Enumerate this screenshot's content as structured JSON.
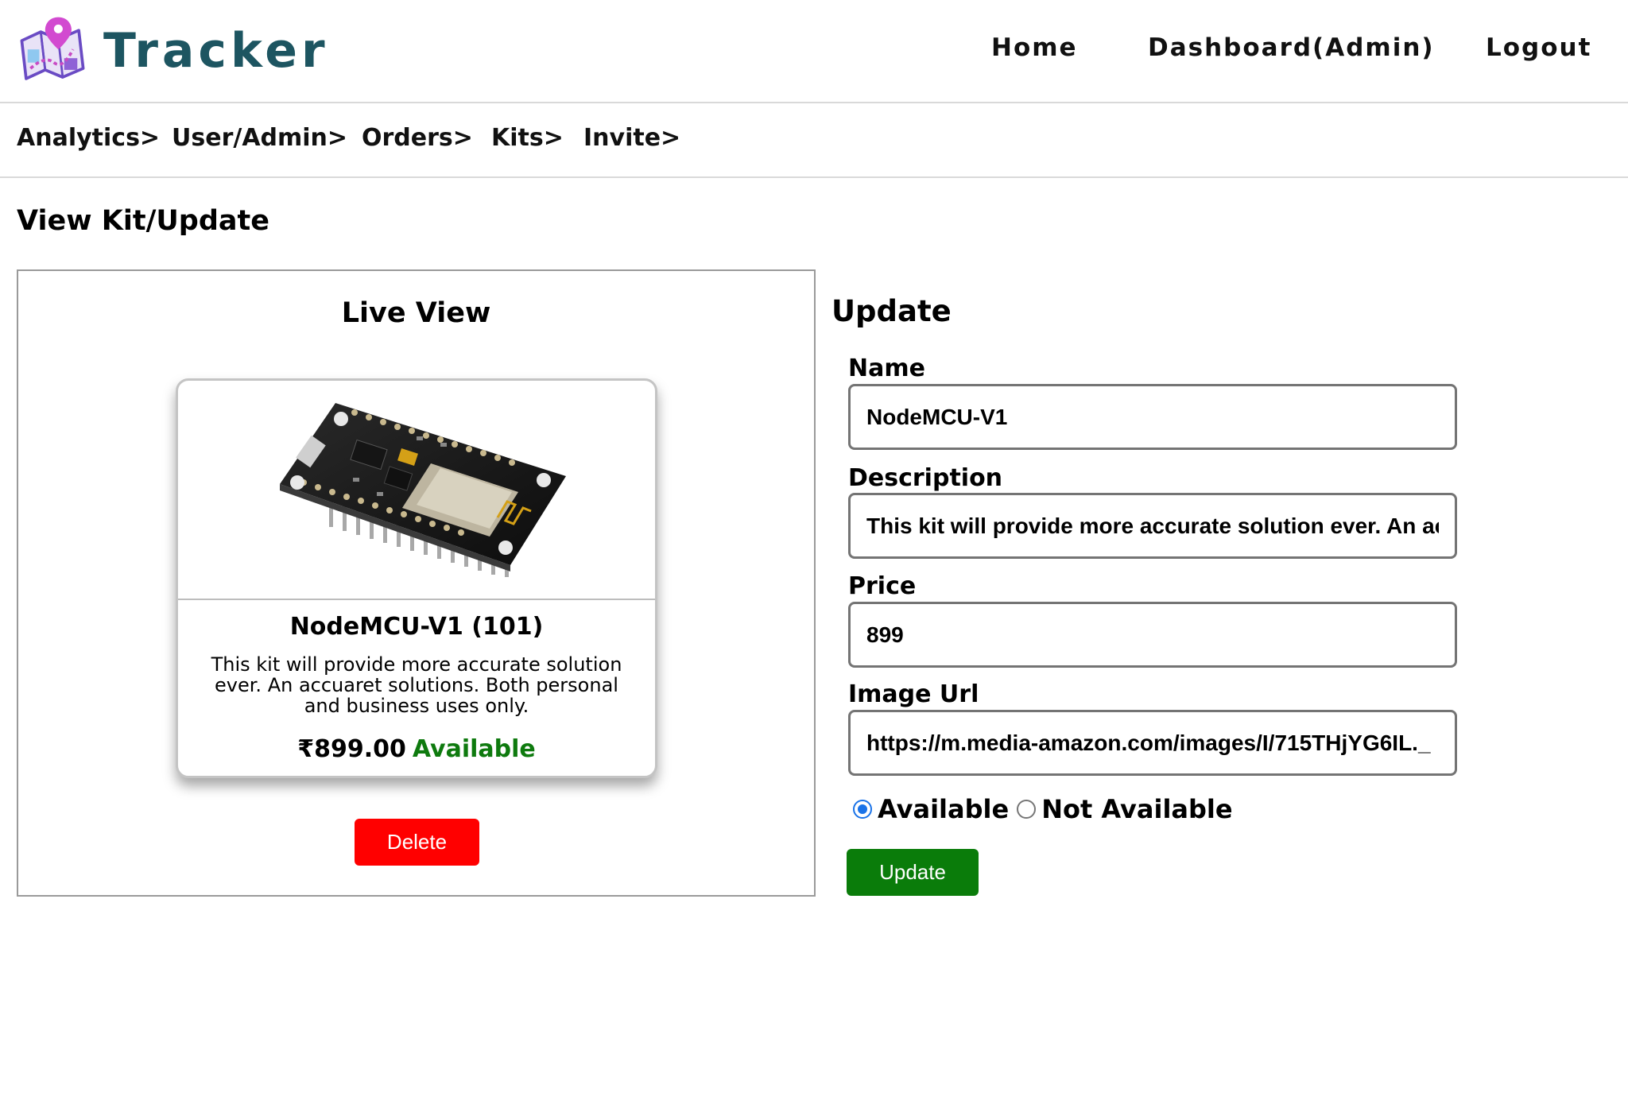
{
  "header": {
    "brand_name": "Tracker",
    "logo_icon": "map-pin-logo-icon",
    "nav": [
      {
        "label": "Home"
      },
      {
        "label": "Dashboard(Admin)"
      },
      {
        "label": "Logout"
      }
    ]
  },
  "subnav": {
    "items": [
      {
        "label": "Analytics>"
      },
      {
        "label": "User/Admin>"
      },
      {
        "label": "Orders>"
      },
      {
        "label": "Kits>"
      },
      {
        "label": "Invite>"
      }
    ]
  },
  "page": {
    "title": "View Kit/Update"
  },
  "live_view": {
    "title": "Live View",
    "card": {
      "image_icon": "nodemcu-board-image",
      "name": "NodeMCU-V1 (101)",
      "description": "This kit will provide more accurate solution ever. An accuaret solutions. Both personal and business uses only.",
      "price": "₹899.00",
      "status": "Available",
      "status_color": "#0e7a0e"
    },
    "delete_label": "Delete",
    "delete_color": "#ff0000"
  },
  "update_form": {
    "title": "Update",
    "fields": {
      "name": {
        "label": "Name",
        "value": "NodeMCU-V1"
      },
      "description": {
        "label": "Description",
        "value": "This kit will provide more accurate solution ever. An accuaret solutions. Both personal and business uses only."
      },
      "price": {
        "label": "Price",
        "value": "899"
      },
      "image_url": {
        "label": "Image Url",
        "value": "https://m.media-amazon.com/images/I/715THjYG6IL._"
      }
    },
    "availability": {
      "options": [
        {
          "label": "Available",
          "selected": true
        },
        {
          "label": "Not Available",
          "selected": false
        }
      ]
    },
    "submit_label": "Update",
    "submit_color": "#0a7c0a"
  },
  "colors": {
    "brand": "#1d5561",
    "radio_accent": "#1a73e8"
  }
}
